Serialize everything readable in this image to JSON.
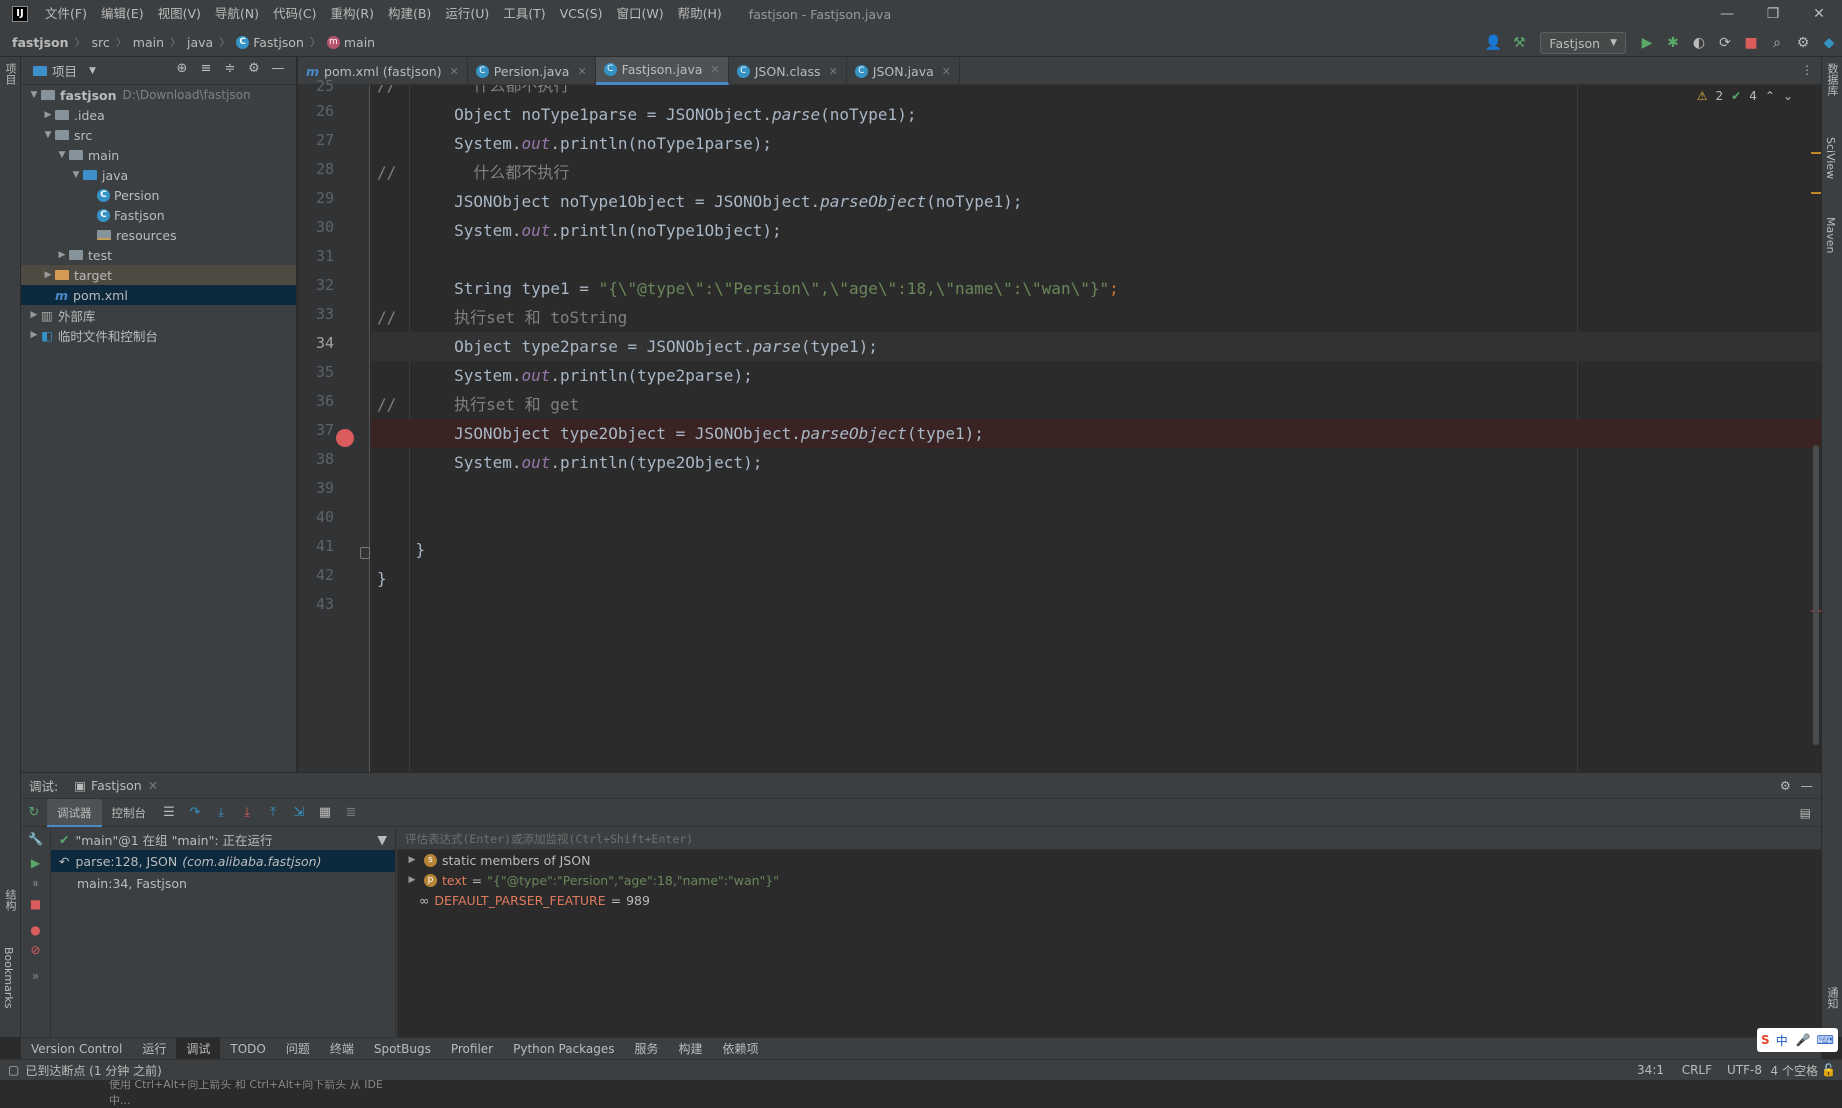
{
  "menubar": {
    "logo": "IJ",
    "items": [
      "文件(F)",
      "编辑(E)",
      "视图(V)",
      "导航(N)",
      "代码(C)",
      "重构(R)",
      "构建(B)",
      "运行(U)",
      "工具(T)",
      "VCS(S)",
      "窗口(W)",
      "帮助(H)"
    ],
    "title": "fastjson - Fastjson.java",
    "min": "—",
    "max": "❐",
    "close": "✕"
  },
  "breadcrumb": {
    "project": "fastjson",
    "src": "src",
    "main": "main",
    "java": "java",
    "file": "Fastjson",
    "method": "main"
  },
  "toolbar": {
    "run_config": "Fastjson"
  },
  "project_panel": {
    "title": "项目",
    "root": "fastjson",
    "root_path": "D:\\Download\\fastjson",
    "items": [
      ".idea",
      "src",
      "main",
      "java",
      "Persion",
      "Fastjson",
      "resources",
      "test",
      "target",
      "pom.xml",
      "外部库",
      "临时文件和控制台"
    ]
  },
  "left_strip": {
    "project": "项目",
    "structure": "结构",
    "bookmarks": "Bookmarks"
  },
  "right_strip": {
    "db": "数据库",
    "sciview": "SciView",
    "maven": "Maven",
    "notify": "通知"
  },
  "tabs": [
    {
      "label": "pom.xml (fastjson)"
    },
    {
      "label": "Persion.java"
    },
    {
      "label": "Fastjson.java"
    },
    {
      "label": "JSON.class"
    },
    {
      "label": "JSON.java"
    }
  ],
  "inspection": {
    "warnings": "2",
    "ok": "4"
  },
  "code": {
    "line_numbers": [
      "25",
      "26",
      "27",
      "28",
      "29",
      "30",
      "31",
      "32",
      "33",
      "34",
      "35",
      "36",
      "37",
      "38",
      "39",
      "40",
      "41",
      "42",
      "43"
    ],
    "c25": "        什么都不执行",
    "c26": "Object noType1parse = JSONObject.",
    "c27": "System.",
    "c28": "        什么都不执行",
    "c29": "JSONObject noType1Object = JSONObject.",
    "c30": "System.",
    "c32a": "String type1 = ",
    "c32b": "\"{\\\"@type\\\":\\\"Persion\\\",\\\"age\\\":18,\\\"name\\\":\\\"wan\\\"}\"",
    "c33": "执行set 和 toString",
    "c34": "Object type2parse = JSONObject.",
    "c35": "System.",
    "c36": "执行set 和 get",
    "c37": "JSONObject type2Object = JSONObject.",
    "c38": "System.",
    "parse": "parse",
    "parseObject": "parseObject",
    "out": "out",
    "println": ".println(",
    "arg1": "(noType1);",
    "arg2": "noType1parse);",
    "arg3": "noType1Object);",
    "arg4": "(type1);",
    "arg5": "type2parse);",
    "arg6": "type2Object);",
    "comment": "//",
    "brace": "}",
    "semi": ";"
  },
  "debug": {
    "label": "调试:",
    "config": "Fastjson",
    "tab_debugger": "调试器",
    "tab_console": "控制台",
    "thread": "\"main\"@1 在组 \"main\": 正在运行",
    "frames": [
      {
        "name": "parse:128, JSON",
        "pkg": "(com.alibaba.fastjson)"
      },
      {
        "name": "main:34, Fastjson",
        "pkg": ""
      }
    ],
    "eval_placeholder": "评估表达式(Enter)或添加监视(Ctrl+Shift+Enter)",
    "vars": [
      {
        "name": "static members of JSON",
        "value": ""
      },
      {
        "name": "text",
        "value": "\"{\"@type\":\"Persion\",\"age\":18,\"name\":\"wan\"}\""
      },
      {
        "name": "DEFAULT_PARSER_FEATURE",
        "value": "989"
      }
    ],
    "hint": "使用 Ctrl+Alt+向上箭头 和 Ctrl+Alt+向下箭头 从 IDE 中..."
  },
  "bottom_tools": [
    "Version Control",
    "运行",
    "调试",
    "TODO",
    "问题",
    "终端",
    "SpotBugs",
    "Profiler",
    "Python Packages",
    "服务",
    "构建",
    "依赖项"
  ],
  "status": {
    "message": "已到达断点 (1 分钟 之前)",
    "position": "34:1",
    "line_sep": "CRLF",
    "encoding": "UTF-8",
    "indent": "4 个空格"
  },
  "ime": {
    "label": "中"
  }
}
